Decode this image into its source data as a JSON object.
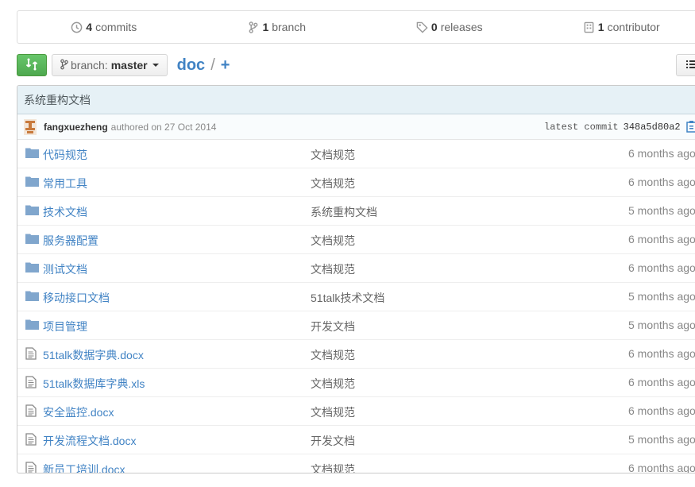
{
  "stats": [
    {
      "icon": "history-icon",
      "count": "4",
      "label": "commits"
    },
    {
      "icon": "branch-icon",
      "count": "1",
      "label": "branch"
    },
    {
      "icon": "tag-icon",
      "count": "0",
      "label": "releases"
    },
    {
      "icon": "organization-icon",
      "count": "1",
      "label": "contributor"
    }
  ],
  "toolbar": {
    "branch_label": "branch:",
    "branch_value": "master",
    "repo": "doc",
    "separator": "/",
    "add": "+"
  },
  "commit": {
    "message": "系统重构文档",
    "author": "fangxuezheng",
    "authored": "authored on 27 Oct 2014",
    "latest_label": "latest commit",
    "sha": "348a5d80a2"
  },
  "files": [
    {
      "type": "folder",
      "name": "代码规范",
      "message": "文档规范",
      "age": "6 months ago"
    },
    {
      "type": "folder",
      "name": "常用工具",
      "message": "文档规范",
      "age": "6 months ago"
    },
    {
      "type": "folder",
      "name": "技术文档",
      "message": "系统重构文档",
      "age": "5 months ago"
    },
    {
      "type": "folder",
      "name": "服务器配置",
      "message": "文档规范",
      "age": "6 months ago"
    },
    {
      "type": "folder",
      "name": "测试文档",
      "message": "文档规范",
      "age": "6 months ago"
    },
    {
      "type": "folder",
      "name": "移动接口文档",
      "message": "51talk技术文档",
      "age": "5 months ago"
    },
    {
      "type": "folder",
      "name": "项目管理",
      "message": "开发文档",
      "age": "5 months ago"
    },
    {
      "type": "file",
      "name": "51talk数据字典.docx",
      "message": "文档规范",
      "age": "6 months ago"
    },
    {
      "type": "file",
      "name": "51talk数据库字典.xls",
      "message": "文档规范",
      "age": "6 months ago"
    },
    {
      "type": "file",
      "name": "安全监控.docx",
      "message": "文档规范",
      "age": "6 months ago"
    },
    {
      "type": "file",
      "name": "开发流程文档.docx",
      "message": "开发文档",
      "age": "5 months ago"
    },
    {
      "type": "file",
      "name": "新员工培训.docx",
      "message": "文档规范",
      "age": "6 months ago"
    }
  ],
  "colors": {
    "link": "#4183c4",
    "compare_green": "#55a532",
    "commit_bg": "#e6f1f6",
    "folder": "#80a6cd"
  }
}
